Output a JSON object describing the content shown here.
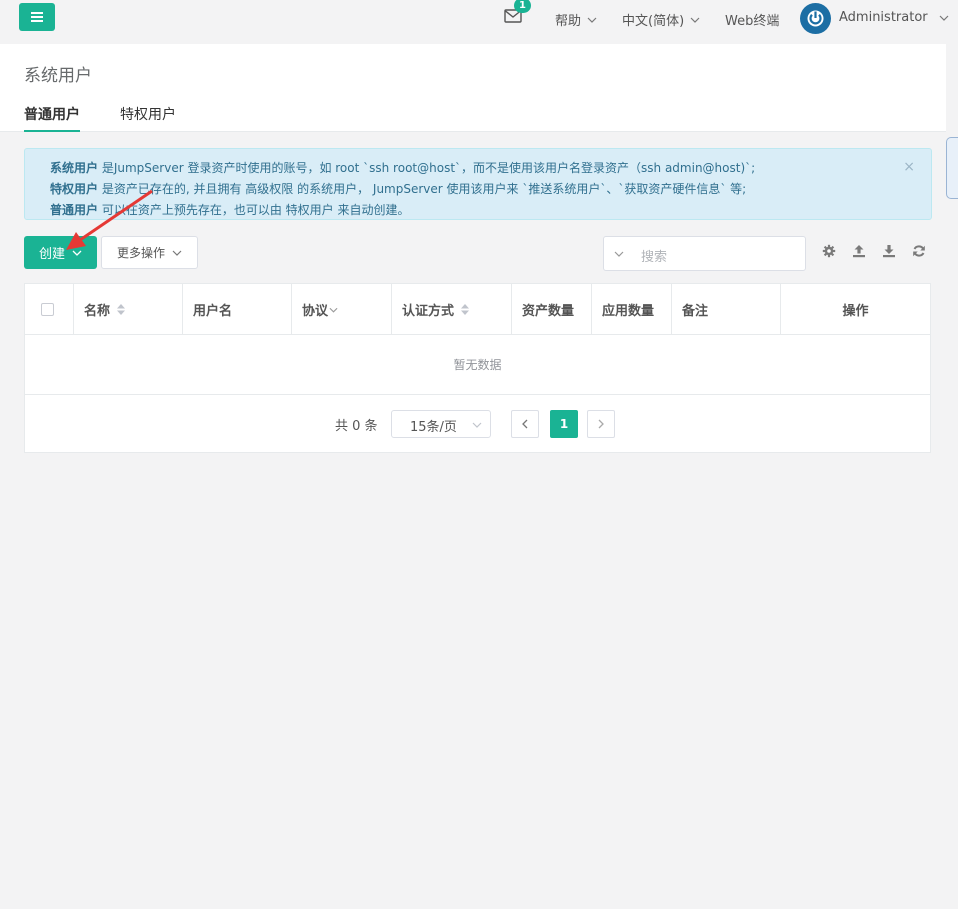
{
  "topbar": {
    "mail_count": "1",
    "help": "帮助",
    "language": "中文(简体)",
    "web_terminal": "Web终端",
    "user": "Administrator"
  },
  "header": {
    "title": "系统用户",
    "tabs": [
      {
        "label": "普通用户",
        "active": true
      },
      {
        "label": "特权用户",
        "active": false
      }
    ]
  },
  "alert": {
    "line1_bold": "系统用户",
    "line1_text": " 是JumpServer 登录资产时使用的账号，如 root `ssh root@host`，而不是使用该用户名登录资产（ssh admin@host)`;",
    "line2_bold": "特权用户",
    "line2_text": " 是资产已存在的, 并且拥有 高级权限 的系统用户， JumpServer 使用该用户来 `推送系统用户`、`获取资产硬件信息` 等;",
    "line3_bold": "普通用户",
    "line3_text": " 可以在资产上预先存在，也可以由 特权用户 来自动创建。",
    "close": "×"
  },
  "toolbar": {
    "create": "创建",
    "more_actions": "更多操作",
    "search_placeholder": "搜索"
  },
  "table": {
    "columns": [
      "名称",
      "用户名",
      "协议",
      "认证方式",
      "资产数量",
      "应用数量",
      "备注",
      "操作"
    ],
    "empty": "暂无数据"
  },
  "pager": {
    "total": "共 0 条",
    "page_size": "15条/页",
    "current_page": "1"
  },
  "colors": {
    "accent": "#1ab394",
    "alert_bg": "#d9edf7",
    "alert_text": "#31708f",
    "annotation_arrow": "#e53935"
  }
}
